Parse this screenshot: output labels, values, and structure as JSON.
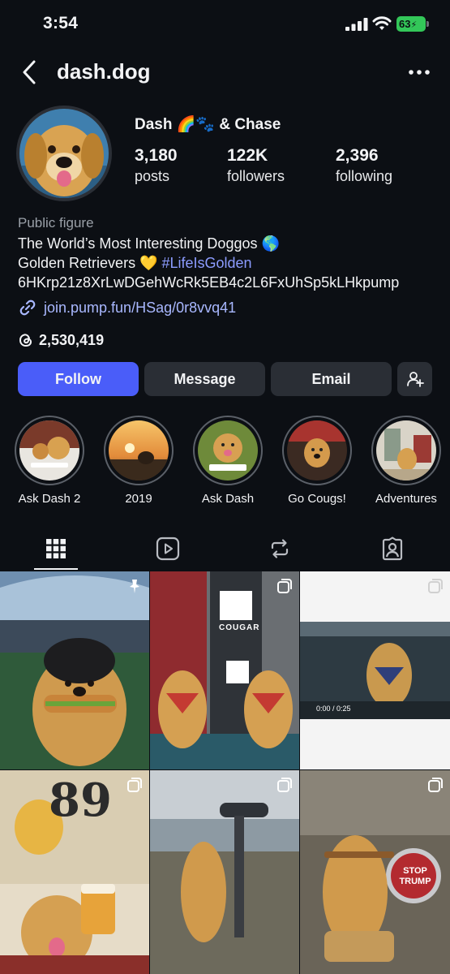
{
  "status_bar": {
    "time": "3:54",
    "battery": "63"
  },
  "header": {
    "username": "dash.dog"
  },
  "profile": {
    "display_name": "Dash 🌈🐾 & Chase",
    "stats": [
      {
        "value": "3,180",
        "label": "posts"
      },
      {
        "value": "122K",
        "label": "followers"
      },
      {
        "value": "2,396",
        "label": "following"
      }
    ],
    "category": "Public figure",
    "bio_line1": "The World’s Most Interesting Doggos 🌎",
    "bio_line2_text": "Golden Retrievers 💛 ",
    "bio_line2_hashtag": "#LifeIsGolden",
    "bio_line3": "6HKrp21z8XrLwDGehWcRk5EB4c2L6FxUhSp5kLHkpump",
    "link": "join.pump.fun/HSag/0r8vvq41",
    "threads_count": "2,530,419"
  },
  "buttons": {
    "follow": "Follow",
    "message": "Message",
    "email": "Email"
  },
  "highlights": [
    {
      "label": "Ask Dash 2"
    },
    {
      "label": "2019"
    },
    {
      "label": "Ask Dash"
    },
    {
      "label": "Go Cougs!"
    },
    {
      "label": "Adventures"
    }
  ],
  "grid_posts": [
    {
      "overlay": "",
      "badge": "pin"
    },
    {
      "overlay": "COUGAR",
      "badge": "multi"
    },
    {
      "overlay": "0:00 / 0:25",
      "badge": "multi"
    },
    {
      "overlay": "89",
      "badge": "multi"
    },
    {
      "overlay": "",
      "badge": "multi"
    },
    {
      "overlay": "STOP TRUMP",
      "badge": "multi"
    }
  ],
  "colors": {
    "accent": "#4a5df9",
    "link": "#a9b8ff",
    "hashtag": "#8c9cff",
    "background": "#0c0f14",
    "button": "#2a2e35"
  }
}
